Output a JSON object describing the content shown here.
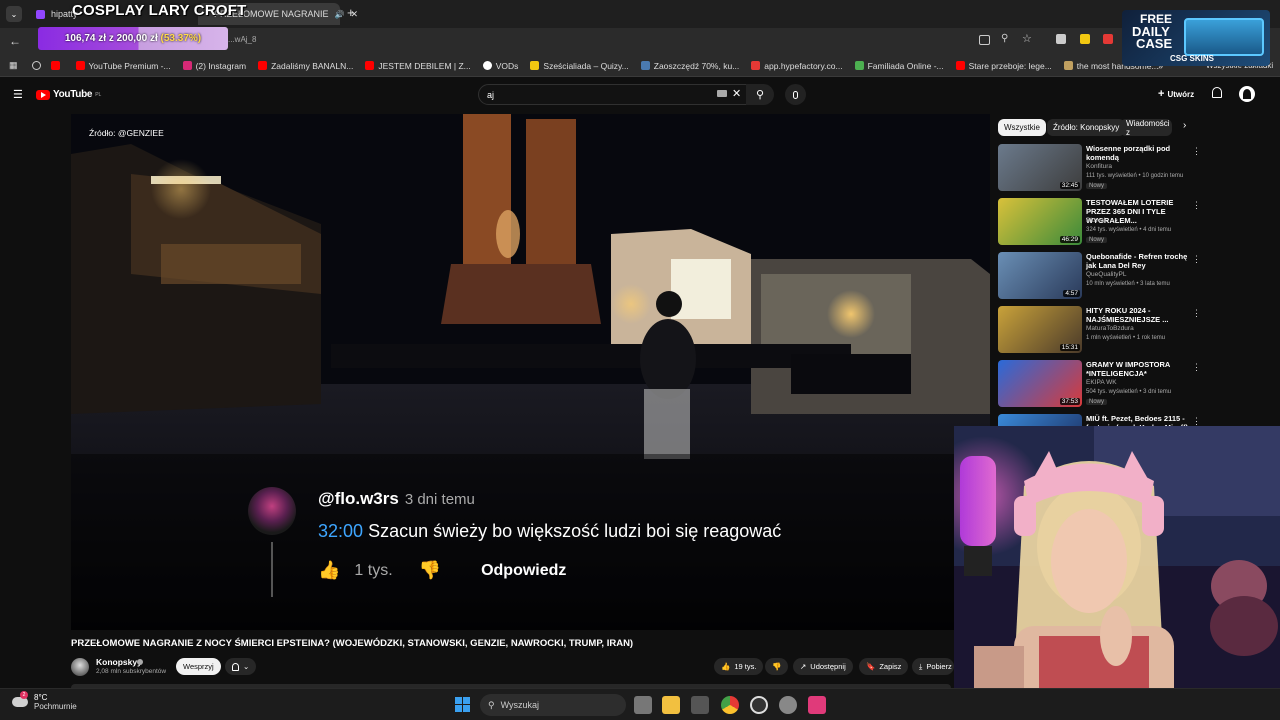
{
  "browser": {
    "tabs": [
      {
        "label": "hipatty",
        "active": false
      },
      {
        "label": "PRZEŁOMOWE NAGRANIE",
        "active": true
      }
    ],
    "url_fragment": "...wAj_8",
    "bookmarks": [
      {
        "label": "",
        "icon": "youtube-icon"
      },
      {
        "label": "YouTube Premium -...",
        "icon": "youtube-icon"
      },
      {
        "label": "(2) Instagram",
        "icon": "instagram-icon"
      },
      {
        "label": "Zadaliśmy BANALN...",
        "icon": "youtube-icon"
      },
      {
        "label": "JESTEM DEBILEM | Z...",
        "icon": "youtube-icon"
      },
      {
        "label": "VODs",
        "icon": "vods-icon"
      },
      {
        "label": "Sześcialiada – Quizy...",
        "icon": "quiz-icon"
      },
      {
        "label": "Zaoszczędź 70%, ku...",
        "icon": "steam-icon"
      },
      {
        "label": "app.hypefactory.co...",
        "icon": "hype-icon"
      },
      {
        "label": "Familiada Online -...",
        "icon": "familiada-icon"
      },
      {
        "label": "Stare przeboje: lege...",
        "icon": "youtube-icon"
      },
      {
        "label": "the most handsome...",
        "icon": "cat-icon"
      }
    ],
    "all_bookmarks_label": "Wszystkie zakładki"
  },
  "overlay": {
    "title": "COSPLAY LARY CROFT",
    "donation_current": "106,74 zł",
    "donation_sep": "z",
    "donation_goal": "200,00 zł",
    "donation_pct": "(53.37%)",
    "donation_fraction": 0.5337,
    "promo_line1": "FREE",
    "promo_line2": "DAILY",
    "promo_line3": "CASE",
    "promo_brand": "CSG SKINS"
  },
  "youtube": {
    "logo_text": "YouTube",
    "logo_suffix": "PL",
    "search_value": "aj",
    "create_label": "Utwórz",
    "video": {
      "source_label": "Źródło: @GENZIEE",
      "comment_user": "@flo.w3rs",
      "comment_time": "3 dni temu",
      "comment_timestamp": "32:00",
      "comment_text": "Szacun świeży bo większość ludzi boi się reagować",
      "comment_likes": "1 tys.",
      "reply_label": "Odpowiedz"
    },
    "title": "PRZEŁOMOWE NAGRANIE Z NOCY ŚMIERCI EPSTEINA? (WOJEWÓDZKI, STANOWSKI, GENZIE, NAWROCKI, TRUMP, IRAN)",
    "channel_name": "Konopskyy",
    "subscribers": "2,08 mln subskrybentów",
    "support_label": "Wesprzyj",
    "likes": "19 tys.",
    "share_label": "Udostępnij",
    "save_label": "Zapisz",
    "download_label": "Pobierz",
    "chips": [
      "Wszystkie",
      "Źródło: Konopskyy",
      "Wiadomości z"
    ],
    "recommended": [
      {
        "title": "Wiosenne porządki pod komendą",
        "channel": "Konfitura",
        "meta": "111 tys. wyświetleń • 10 godzin temu",
        "duration": "32:45",
        "badge": "Nowy",
        "color1": "#6b7a8c",
        "color2": "#3d3d3d"
      },
      {
        "title": "TESTOWAŁEM LOTERIE PRZEZ 365 DNI I TYLE WYGRAŁEM...",
        "channel": "Blowek",
        "meta": "324 tys. wyświetleń • 4 dni temu",
        "duration": "46:29",
        "badge": "Nowy",
        "color1": "#d9c13a",
        "color2": "#3a8a3a"
      },
      {
        "title": "Quebonafide - Refren trochę jak Lana Del Rey",
        "channel": "QueQualityPL",
        "meta": "10 mln wyświetleń • 3 lata temu",
        "duration": "4:57",
        "badge": "",
        "color1": "#6a8fb5",
        "color2": "#2a3a5a"
      },
      {
        "title": "HITY ROKU 2024 - NAJŚMIESZNIEJSZE ...",
        "channel": "MaturaToBzdura",
        "meta": "1 mln wyświetleń • 1 rok temu",
        "duration": "15:31",
        "badge": "",
        "color1": "#c9a23a",
        "color2": "#4a3a2a"
      },
      {
        "title": "GRAMY W IMPOSTORA *INTELIGENCJA*",
        "channel": "EKIPA WK",
        "meta": "504 tys. wyświetleń • 3 dni temu",
        "duration": "37:53",
        "badge": "Nowy",
        "color1": "#2a6ad9",
        "color2": "#d93a3a"
      },
      {
        "title": "MIÜ ft. Pezet, Bedoes 2115 - fantazje (prod. Koder, Miroff)",
        "channel": "",
        "meta": "",
        "duration": "",
        "badge": "",
        "color1": "#3a8ad9",
        "color2": "#1a2a5a"
      }
    ]
  },
  "taskbar": {
    "weather_temp": "8°C",
    "weather_desc": "Pochmurnie",
    "search_placeholder": "Wyszukaj"
  }
}
